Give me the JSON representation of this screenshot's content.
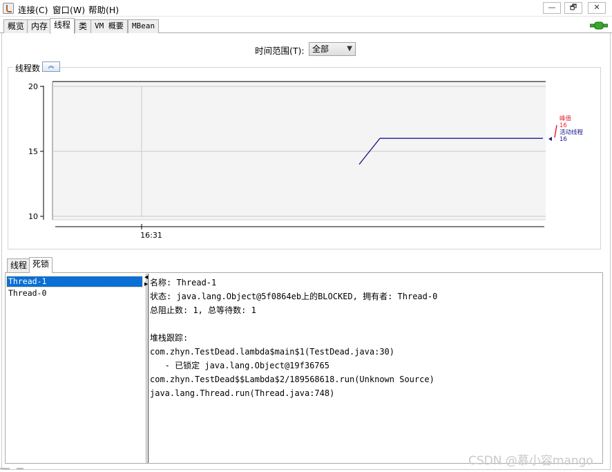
{
  "menu": [
    "连接(C)",
    "窗口(W)",
    "帮助(H)"
  ],
  "window_controls": [
    "—",
    "🗗",
    "✕"
  ],
  "tabs": [
    "概览",
    "内存",
    "线程",
    "类",
    "VM 概要",
    "MBean"
  ],
  "active_tab": "线程",
  "time_range": {
    "label": "时间范围(T):",
    "value": "全部"
  },
  "chart": {
    "title": "线程数",
    "legend": [
      {
        "name": "峰值",
        "value": "16",
        "color": "#e8222c"
      },
      {
        "name": "活动线程",
        "value": "16",
        "color": "#1a1a8c"
      }
    ]
  },
  "chart_data": {
    "type": "line",
    "ylim": [
      10,
      20
    ],
    "yticks": [
      "20",
      "15",
      "10"
    ],
    "xticks": [
      "16:31"
    ],
    "series": [
      {
        "name": "峰值",
        "values": [
          16
        ],
        "color": "#e8222c"
      },
      {
        "name": "活动线程",
        "values": [
          14,
          16,
          16
        ],
        "color": "#1a1a8c"
      }
    ]
  },
  "subtabs": [
    "线程",
    "死锁"
  ],
  "active_subtab": "死锁",
  "threads": [
    "Thread-1",
    "Thread-0"
  ],
  "selected_thread": "Thread-1",
  "details": [
    "名称: Thread-1",
    "状态: java.lang.Object@5f0864eb上的BLOCKED, 拥有者: Thread-0",
    "总阻止数: 1, 总等待数: 1",
    "",
    "堆栈跟踪:",
    "com.zhyn.TestDead.lambda$main$1(TestDead.java:30)",
    "   - 已锁定 java.lang.Object@19f36765",
    "com.zhyn.TestDead$$Lambda$2/189568618.run(Unknown Source)",
    "java.lang.Thread.run(Thread.java:748)"
  ],
  "watermark": "CSDN @慕小容mango"
}
